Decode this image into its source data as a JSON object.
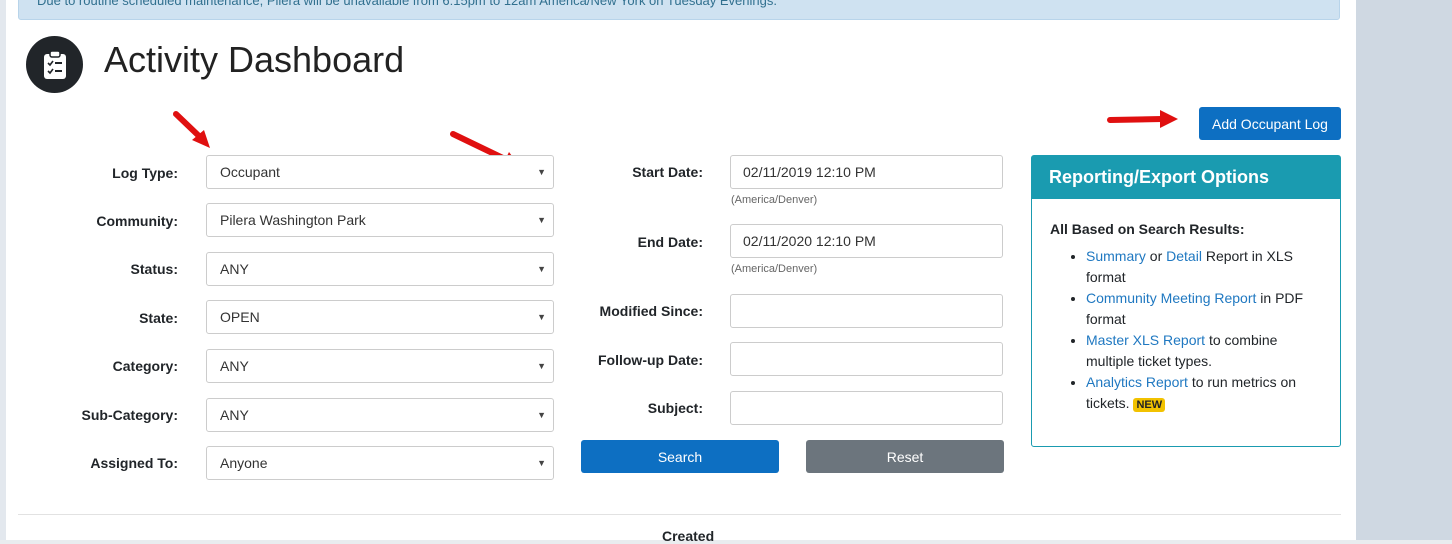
{
  "banner": {
    "text": "Due to routine scheduled maintenance, Pilera will be unavailable from 6:15pm to 12am America/New York on Tuesday Evenings."
  },
  "page": {
    "title": "Activity Dashboard",
    "icon": "clipboard-checklist-icon"
  },
  "actions": {
    "add_log": "Add Occupant Log"
  },
  "filters": {
    "log_type": {
      "label": "Log Type:",
      "value": "Occupant"
    },
    "community": {
      "label": "Community:",
      "value": "Pilera Washington Park"
    },
    "status": {
      "label": "Status:",
      "value": "ANY"
    },
    "state": {
      "label": "State:",
      "value": "OPEN"
    },
    "category": {
      "label": "Category:",
      "value": "ANY"
    },
    "sub_category": {
      "label": "Sub-Category:",
      "value": "ANY"
    },
    "assigned_to": {
      "label": "Assigned To:",
      "value": "Anyone"
    },
    "start_date": {
      "label": "Start Date:",
      "value": "02/11/2019 12:10 PM",
      "tz": "(America/Denver)"
    },
    "end_date": {
      "label": "End Date:",
      "value": "02/11/2020 12:10 PM",
      "tz": "(America/Denver)"
    },
    "modified_since": {
      "label": "Modified Since:",
      "value": ""
    },
    "followup_date": {
      "label": "Follow-up Date:",
      "value": ""
    },
    "subject": {
      "label": "Subject:",
      "value": ""
    }
  },
  "buttons": {
    "search": "Search",
    "reset": "Reset"
  },
  "reporting": {
    "title": "Reporting/Export Options",
    "subtitle": "All Based on Search Results:",
    "items": [
      {
        "link1": "Summary",
        "mid": " or ",
        "link2": "Detail",
        "rest": " Report in XLS format"
      },
      {
        "link1": "Community Meeting Report",
        "rest": " in PDF format"
      },
      {
        "link1": "Master XLS Report",
        "rest": " to combine multiple ticket types."
      },
      {
        "link1": "Analytics Report",
        "rest": " to run metrics on tickets. ",
        "badge": "NEW"
      }
    ]
  },
  "table": {
    "created_header": "Created"
  },
  "colors": {
    "primary": "#0d6fc2",
    "panel": "#1a9bb0",
    "annotation_arrow": "#e01010"
  }
}
